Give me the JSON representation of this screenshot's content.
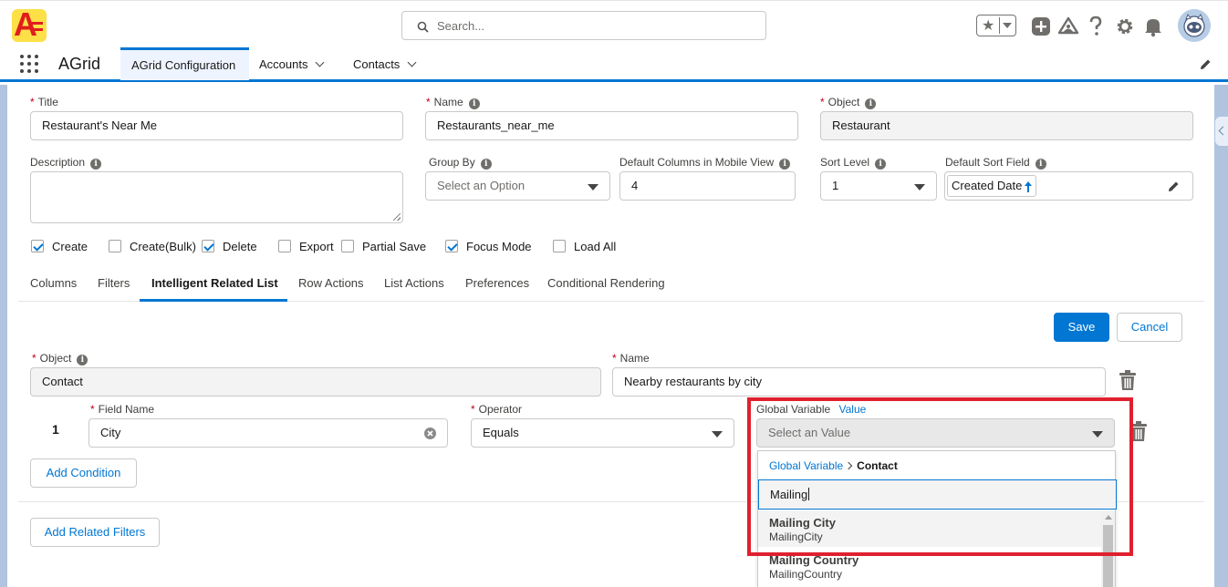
{
  "header": {
    "search_placeholder": "Search...",
    "icons": [
      "favorites-star-icon",
      "add-icon",
      "trailhead-icon",
      "help-icon",
      "settings-gear-icon",
      "notifications-bell-icon",
      "user-avatar"
    ]
  },
  "nav": {
    "app_name": "AGrid",
    "tabs": [
      {
        "label": "AGrid Configuration",
        "active": true
      },
      {
        "label": "Accounts",
        "has_menu": true
      },
      {
        "label": "Contacts",
        "has_menu": true
      }
    ]
  },
  "form": {
    "title": {
      "label": "Title",
      "value": "Restaurant's Near Me"
    },
    "name": {
      "label": "Name",
      "value": "Restaurants_near_me"
    },
    "object": {
      "label": "Object",
      "value": "Restaurant"
    },
    "description": {
      "label": "Description",
      "value": ""
    },
    "group_by": {
      "label": "Group By",
      "placeholder": "Select an Option"
    },
    "default_columns_mobile": {
      "label": "Default Columns in Mobile View",
      "value": "4"
    },
    "sort_level": {
      "label": "Sort Level",
      "value": "1"
    },
    "default_sort_field": {
      "label": "Default Sort Field",
      "value": "Created Date",
      "direction": "ascending"
    }
  },
  "options": [
    {
      "label": "Create",
      "checked": true
    },
    {
      "label": "Create(Bulk)",
      "checked": false
    },
    {
      "label": "Delete",
      "checked": true
    },
    {
      "label": "Export",
      "checked": false
    },
    {
      "label": "Partial Save",
      "checked": false
    },
    {
      "label": "Focus Mode",
      "checked": true
    },
    {
      "label": "Load All",
      "checked": false
    }
  ],
  "subtabs": [
    {
      "label": "Columns"
    },
    {
      "label": "Filters"
    },
    {
      "label": "Intelligent Related List",
      "active": true
    },
    {
      "label": "Row Actions"
    },
    {
      "label": "List Actions"
    },
    {
      "label": "Preferences"
    },
    {
      "label": "Conditional Rendering"
    }
  ],
  "related": {
    "save_label": "Save",
    "cancel_label": "Cancel",
    "object": {
      "label": "Object",
      "value": "Contact"
    },
    "name": {
      "label": "Name",
      "value": "Nearby restaurants by city"
    },
    "condition": {
      "index": "1",
      "field_name": {
        "label": "Field Name",
        "value": "City"
      },
      "operator": {
        "label": "Operator",
        "value": "Equals"
      },
      "value_toggle": {
        "global_label": "Global Variable",
        "value_label": "Value"
      },
      "value_placeholder": "Select an Value"
    },
    "add_condition_label": "Add Condition",
    "add_related_filters_label": "Add Related Filters"
  },
  "dropdown": {
    "crumb_root": "Global Variable",
    "crumb_current": "Contact",
    "search_text": "Mailing",
    "options": [
      {
        "title": "Mailing City",
        "api": "MailingCity",
        "highlighted": true
      },
      {
        "title": "Mailing Country",
        "api": "MailingCountry",
        "highlighted": false
      }
    ]
  },
  "colors": {
    "brand": "#0176d3",
    "required": "#ba0517",
    "highlight_box": "#e0202e",
    "logo_bg": "#fde047",
    "logo_fg": "#e11d1d"
  }
}
